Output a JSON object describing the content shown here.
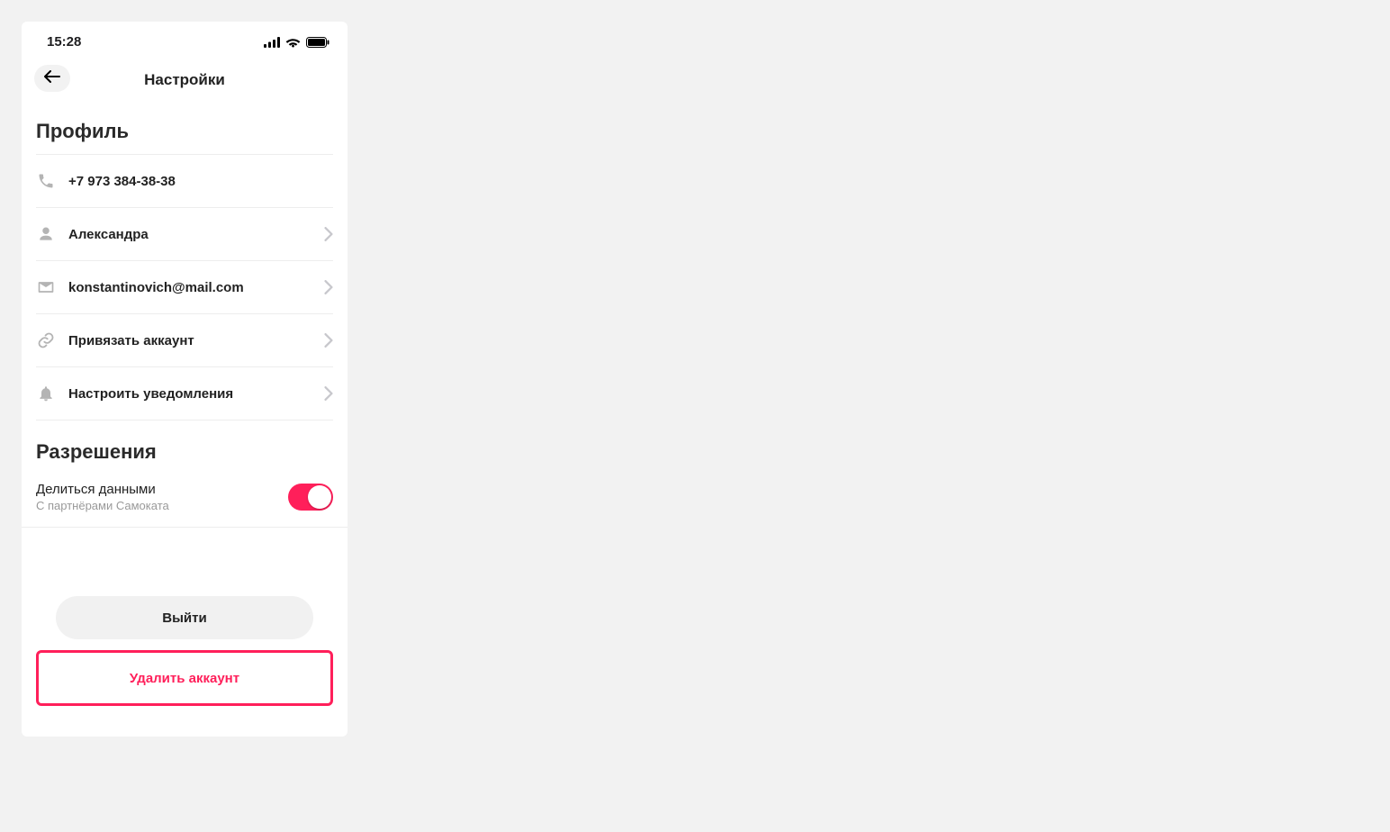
{
  "status_bar": {
    "time": "15:28"
  },
  "header": {
    "title": "Настройки"
  },
  "sections": {
    "profile_title": "Профиль",
    "permissions_title": "Разрешения"
  },
  "profile": {
    "phone": "+7 973 384-38-38",
    "name": "Александра",
    "email": "konstantinovich@mail.com",
    "link_account": "Привязать аккаунт",
    "notifications": "Настроить уведомления"
  },
  "permissions": {
    "share_data_title": "Делиться данными",
    "share_data_subtitle": "С партнёрами Самоката",
    "share_data_enabled": true
  },
  "buttons": {
    "logout": "Выйти",
    "delete_account": "Удалить аккаунт"
  },
  "colors": {
    "accent": "#ff1f5a",
    "bg": "#f2f2f2",
    "divider": "#ededed",
    "muted": "#9a9a9a"
  }
}
